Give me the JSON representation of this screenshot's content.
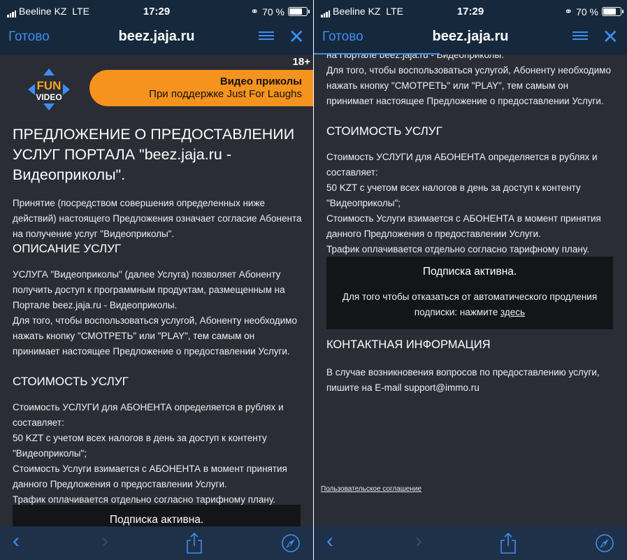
{
  "status": {
    "carrier": "Beeline KZ",
    "network": "LTE",
    "time": "17:29",
    "battery": "70 %"
  },
  "nav": {
    "done": "Готово",
    "url": "beez.jaja.ru",
    "reader_icon": "reader-icon",
    "close": "✕"
  },
  "banner": {
    "age": "18+",
    "line1": "Видео приколы",
    "line2": "При поддержке Just For Laughs",
    "logo_top": "FUN",
    "logo_bottom": "VIDEO"
  },
  "title": "ПРЕДЛОЖЕНИЕ О ПРЕДОСТАВЛЕНИИ УСЛУГ ПОРТАЛА \"beez.jaja.ru - Видеоприколы\".",
  "intro": "Принятие (посредством совершения определенных ниже действий) настоящего Предложения означает согласие Абонента на получение услуг \"Видеоприколы\".",
  "desc_heading": "ОПИСАНИЕ УСЛУГ",
  "desc_p1": "УСЛУГА \"Видеоприколы\" (далее Услуга) позволяет Абоненту получить доступ к программным продуктам, размещенным на Портале beez.jaja.ru - Видеоприколы.",
  "desc_cut": "на Портале beez.jaja.ru - Видеоприколы.",
  "desc_p2": "Для того, чтобы воспользоваться услугой, Абоненту необходимо нажать кнопку \"СМОТРЕТЬ\" или \"PLAY\", тем самым он принимает настоящее Предложение о предоставлении Услуги.",
  "cost_heading": "СТОИМОСТЬ УСЛУГ",
  "cost_p1": "Стоимость УСЛУГИ для АБОНЕНТА определяется в рублях и составляет:",
  "cost_p2": "50 KZT с учетом всех налогов в день за доступ к контенту \"Видеоприколы\";",
  "cost_p3": "Стоимость Услуги взимается с АБОНЕНТА в момент принятия данного Предложения о предоставлении Услуги.",
  "cost_p4": "Трафик оплачивается отдельно согласно тарифному плану.",
  "sub": {
    "title": "Подписка активна.",
    "text": "Для того чтобы отказаться от автоматического продления подписки: нажмите",
    "link": "здесь"
  },
  "contact_heading": "КОНТАКТНАЯ ИНФОРМАЦИЯ",
  "contact_text": "В случае возникновения вопросов по предоставлению услуги, пишите на E-mail support@immo.ru",
  "user_agreement": "Пользовательское соглашение",
  "toolbar": {
    "back": "‹",
    "forward": "›"
  }
}
